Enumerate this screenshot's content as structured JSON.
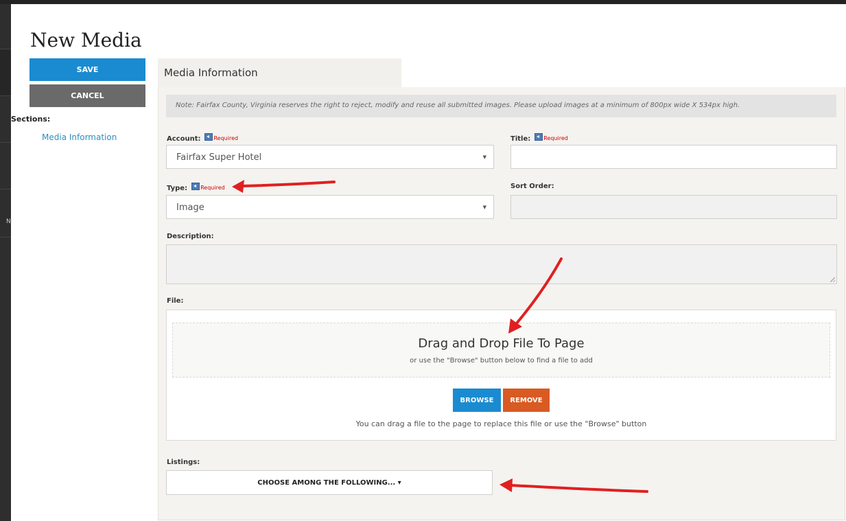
{
  "page": {
    "title": "New Media"
  },
  "actions": {
    "save_label": "SAVE",
    "cancel_label": "CANCEL"
  },
  "sections": {
    "label": "Sections:",
    "items": [
      "Media Information"
    ]
  },
  "tab": {
    "label": "Media Information"
  },
  "note": "Note: Fairfax County, Virginia reserves the right to reject, modify and reuse all submitted images. Please upload images at a minimum of 800px wide X 534px high.",
  "form": {
    "required_text": "Required",
    "account": {
      "label": "Account:",
      "value": "Fairfax Super Hotel"
    },
    "title": {
      "label": "Title:",
      "value": ""
    },
    "type": {
      "label": "Type:",
      "value": "Image"
    },
    "sort_order": {
      "label": "Sort Order:",
      "value": ""
    },
    "description": {
      "label": "Description:",
      "value": ""
    },
    "file": {
      "label": "File:",
      "drop_title": "Drag and Drop File To Page",
      "drop_sub": "or use the \"Browse\" button below to find a file to add",
      "browse_label": "BROWSE",
      "remove_label": "REMOVE",
      "hint": "You can drag a file to the page to replace this file or use the \"Browse\" button"
    },
    "listings": {
      "label": "Listings:",
      "choose_label": "CHOOSE AMONG THE FOLLOWING... ▾"
    }
  },
  "icons": {
    "required": "arrow-left-icon",
    "select_caret": "caret-down-icon"
  },
  "colors": {
    "primary": "#1a8bd0",
    "cancel": "#6a6a6a",
    "remove": "#d95a22",
    "required": "#cc0000",
    "annotation_arrow": "#e02020"
  }
}
